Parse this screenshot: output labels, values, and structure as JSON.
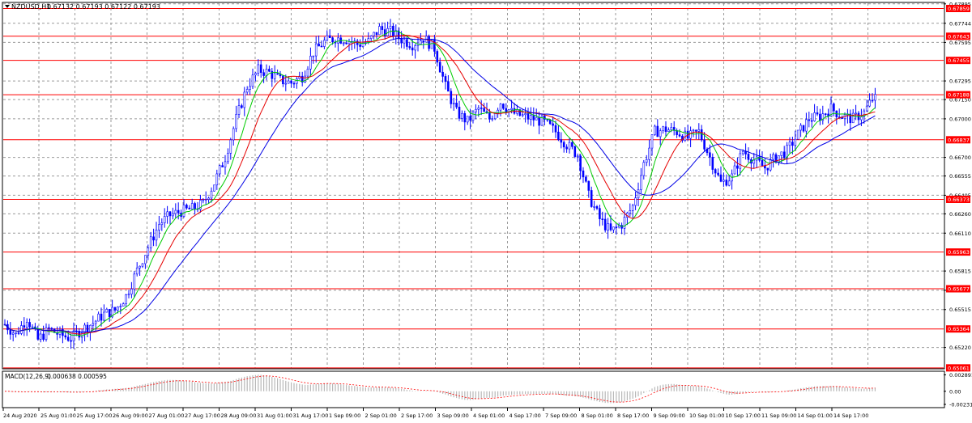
{
  "header": {
    "symbol_label": "NZDUSD,H1",
    "ohlc_text": "0.67132 0.67193 0.67122 0.67193"
  },
  "macd": {
    "label": "MACD(12,26,9)",
    "values_text": "0.000638 0.000595",
    "axis_ticks": [
      "0.002891",
      "0.00",
      "-0.002315"
    ]
  },
  "chart_data": {
    "type": "candlestick",
    "symbol": "NZDUSD",
    "timeframe": "H1",
    "ylim": [
      0.6506,
      0.679
    ],
    "price_ticks": [
      {
        "value": 0.67895,
        "label": "0.67895"
      },
      {
        "value": 0.67744,
        "label": "0.67744"
      },
      {
        "value": 0.67595,
        "label": "0.67595"
      },
      {
        "value": 0.67295,
        "label": "0.67295"
      },
      {
        "value": 0.6715,
        "label": "0.67150"
      },
      {
        "value": 0.67,
        "label": "0.67000"
      },
      {
        "value": 0.667,
        "label": "0.66700"
      },
      {
        "value": 0.66555,
        "label": "0.66555"
      },
      {
        "value": 0.66405,
        "label": "0.66405"
      },
      {
        "value": 0.6626,
        "label": "0.66260"
      },
      {
        "value": 0.6611,
        "label": "0.66110"
      },
      {
        "value": 0.65815,
        "label": "0.65815"
      },
      {
        "value": 0.65665,
        "label": "0.65665"
      },
      {
        "value": 0.65515,
        "label": "0.65515"
      },
      {
        "value": 0.6522,
        "label": "0.65220"
      }
    ],
    "levels": [
      {
        "value": 0.67859,
        "label": "0.67859"
      },
      {
        "value": 0.67643,
        "label": "0.67643"
      },
      {
        "value": 0.67455,
        "label": "0.67455"
      },
      {
        "value": 0.67188,
        "label": "0.67188"
      },
      {
        "value": 0.66837,
        "label": "0.66837"
      },
      {
        "value": 0.66373,
        "label": "0.66373"
      },
      {
        "value": 0.65963,
        "label": "0.65963"
      },
      {
        "value": 0.65677,
        "label": "0.65677"
      },
      {
        "value": 0.65364,
        "label": "0.65364"
      },
      {
        "value": 0.65061,
        "label": "0.65061"
      }
    ],
    "time_labels": [
      "24 Aug 2020",
      "25 Aug 01:00",
      "25 Aug 17:00",
      "26 Aug 09:00",
      "27 Aug 01:00",
      "27 Aug 17:00",
      "28 Aug 09:00",
      "31 Aug 01:00",
      "31 Aug 17:00",
      "1 Sep 09:00",
      "2 Sep 01:00",
      "2 Sep 17:00",
      "3 Sep 09:00",
      "4 Sep 01:00",
      "4 Sep 17:00",
      "7 Sep 09:00",
      "8 Sep 01:00",
      "8 Sep 17:00",
      "9 Sep 09:00",
      "10 Sep 01:00",
      "10 Sep 17:00",
      "11 Sep 09:00",
      "14 Sep 01:00",
      "14 Sep 17:00"
    ],
    "price_keypoints": [
      [
        0,
        0.654
      ],
      [
        4,
        0.6532
      ],
      [
        8,
        0.6545
      ],
      [
        12,
        0.6528
      ],
      [
        16,
        0.6536
      ],
      [
        20,
        0.6532
      ],
      [
        24,
        0.6529
      ],
      [
        28,
        0.6536
      ],
      [
        32,
        0.6541
      ],
      [
        36,
        0.6548
      ],
      [
        40,
        0.6551
      ],
      [
        44,
        0.6562
      ],
      [
        48,
        0.6582
      ],
      [
        52,
        0.66
      ],
      [
        56,
        0.6618
      ],
      [
        60,
        0.6625
      ],
      [
        64,
        0.6628
      ],
      [
        68,
        0.663
      ],
      [
        72,
        0.6634
      ],
      [
        76,
        0.665
      ],
      [
        80,
        0.667
      ],
      [
        84,
        0.67
      ],
      [
        88,
        0.6725
      ],
      [
        92,
        0.6738
      ],
      [
        96,
        0.6736
      ],
      [
        100,
        0.673
      ],
      [
        104,
        0.6728
      ],
      [
        108,
        0.6733
      ],
      [
        112,
        0.6752
      ],
      [
        116,
        0.676
      ],
      [
        120,
        0.6763
      ],
      [
        124,
        0.6762
      ],
      [
        128,
        0.6758
      ],
      [
        132,
        0.676
      ],
      [
        136,
        0.677
      ],
      [
        140,
        0.6768
      ],
      [
        144,
        0.6762
      ],
      [
        148,
        0.6758
      ],
      [
        152,
        0.6763
      ],
      [
        156,
        0.6755
      ],
      [
        160,
        0.6725
      ],
      [
        164,
        0.6705
      ],
      [
        168,
        0.6698
      ],
      [
        172,
        0.6708
      ],
      [
        176,
        0.67
      ],
      [
        180,
        0.6713
      ],
      [
        184,
        0.6705
      ],
      [
        188,
        0.6702
      ],
      [
        192,
        0.67
      ],
      [
        196,
        0.6697
      ],
      [
        200,
        0.669
      ],
      [
        204,
        0.668
      ],
      [
        208,
        0.6672
      ],
      [
        212,
        0.664
      ],
      [
        216,
        0.6622
      ],
      [
        220,
        0.6612
      ],
      [
        224,
        0.6618
      ],
      [
        228,
        0.6632
      ],
      [
        232,
        0.6665
      ],
      [
        236,
        0.669
      ],
      [
        240,
        0.6692
      ],
      [
        244,
        0.669
      ],
      [
        248,
        0.6685
      ],
      [
        252,
        0.669
      ],
      [
        256,
        0.667
      ],
      [
        260,
        0.665
      ],
      [
        264,
        0.6655
      ],
      [
        268,
        0.6675
      ],
      [
        272,
        0.6668
      ],
      [
        276,
        0.6662
      ],
      [
        280,
        0.667
      ],
      [
        284,
        0.6675
      ],
      [
        288,
        0.6688
      ],
      [
        292,
        0.67
      ],
      [
        296,
        0.6702
      ],
      [
        300,
        0.6708
      ],
      [
        304,
        0.6702
      ],
      [
        308,
        0.67
      ],
      [
        312,
        0.6705
      ],
      [
        316,
        0.6719
      ]
    ],
    "indicators": [
      {
        "name": "MA fast",
        "color": "#00cc00",
        "period": 8
      },
      {
        "name": "MA medium",
        "color": "#e60000",
        "period": 16
      },
      {
        "name": "MA slow",
        "color": "#0000e6",
        "period": 30
      }
    ],
    "grid": true,
    "macd_ylim": [
      -0.0026,
      0.0031
    ]
  },
  "colors": {
    "candle": "#0000ff",
    "level": "#ff0000",
    "grid": "#9a9a9a",
    "macd_hist": "#b8b8b8",
    "macd_signal": "#ff0000"
  }
}
